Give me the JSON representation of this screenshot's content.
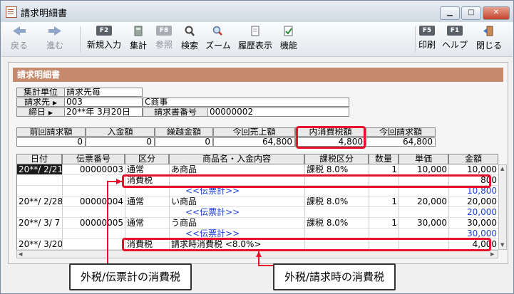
{
  "window": {
    "title": "請求明細書",
    "minimize_glyph": "▁",
    "maximize_glyph": "□",
    "close_glyph": "✕"
  },
  "toolbar": {
    "back": {
      "label": "戻る",
      "icon": "back-arrow-icon"
    },
    "forward": {
      "label": "進む",
      "icon": "forward-arrow-icon"
    },
    "new_entry": {
      "key": "F2",
      "label": "新規入力"
    },
    "total": {
      "label": "集計",
      "icon": "calculator-icon"
    },
    "reference": {
      "key": "F8",
      "label": "参照"
    },
    "search": {
      "label": "検索",
      "icon": "magnifier-icon"
    },
    "zoom": {
      "label": "ズーム",
      "icon": "zoom-icon"
    },
    "history": {
      "label": "履歴表示",
      "icon": "history-icon"
    },
    "functions": {
      "label": "機能",
      "icon": "function-icon"
    },
    "print": {
      "key": "F5",
      "label": "印刷"
    },
    "help": {
      "key": "F1",
      "label": "ヘルプ"
    },
    "close": {
      "label": "閉じる",
      "icon": "exit-icon"
    }
  },
  "panel": {
    "header": "請求明細書"
  },
  "info": {
    "unit_label": "集計単位",
    "unit_value": "請求先毎",
    "billto_label": "請求先",
    "billto_code": "003",
    "billto_name": "C商事",
    "closing_label": "締日",
    "closing_value": "20**年 3月20日",
    "invoice_no_label": "請求書番号",
    "invoice_no_value": "00000002"
  },
  "summary": {
    "headers": [
      "前回請求額",
      "入金額",
      "繰越金額",
      "今回売上額",
      "内消費税額",
      "今回請求額"
    ],
    "values": [
      "0",
      "0",
      "0",
      "64,800",
      "4,800",
      "64,800"
    ]
  },
  "grid": {
    "columns": [
      "日付",
      "伝票番号",
      "区分",
      "商品名・入金内容",
      "課税区分",
      "数量",
      "単価",
      "金額"
    ],
    "rows": [
      {
        "date": "20**/ 2/21",
        "slip": "00000003",
        "kind": "通常",
        "item": "あ商品",
        "tax": "課税 8.0%",
        "qty": "1",
        "price": "10,000",
        "amount": "10,000",
        "blue": false
      },
      {
        "date": "",
        "slip": "",
        "kind": "消費税",
        "item": "",
        "tax": "",
        "qty": "",
        "price": "",
        "amount": "800",
        "blue": false
      },
      {
        "date": "",
        "slip": "",
        "kind": "",
        "item": "<<伝票計>>",
        "tax": "",
        "qty": "",
        "price": "",
        "amount": "10,800",
        "blue": true
      },
      {
        "date": "20**/ 2/28",
        "slip": "00000004",
        "kind": "通常",
        "item": "い商品",
        "tax": "課税 8.0%",
        "qty": "1",
        "price": "20,000",
        "amount": "20,000",
        "blue": false
      },
      {
        "date": "",
        "slip": "",
        "kind": "",
        "item": "<<伝票計>>",
        "tax": "",
        "qty": "",
        "price": "",
        "amount": "20,000",
        "blue": true
      },
      {
        "date": "20**/ 3/ 7",
        "slip": "00000005",
        "kind": "通常",
        "item": "う商品",
        "tax": "課税 8.0%",
        "qty": "1",
        "price": "30,000",
        "amount": "30,000",
        "blue": false
      },
      {
        "date": "",
        "slip": "",
        "kind": "",
        "item": "<<伝票計>>",
        "tax": "",
        "qty": "",
        "price": "",
        "amount": "30,000",
        "blue": true
      },
      {
        "date": "20**/ 3/20",
        "slip": "",
        "kind": "消費税",
        "item": "請求時消費税 <8.0%>",
        "tax": "",
        "qty": "",
        "price": "",
        "amount": "4,000",
        "blue": false
      }
    ]
  },
  "callouts": {
    "left": "外税/伝票計の消費税",
    "right": "外税/請求時の消費税"
  },
  "colors": {
    "accent_header": "#c6896b",
    "highlight": "#e8112d",
    "link_blue": "#1a3fd6"
  }
}
